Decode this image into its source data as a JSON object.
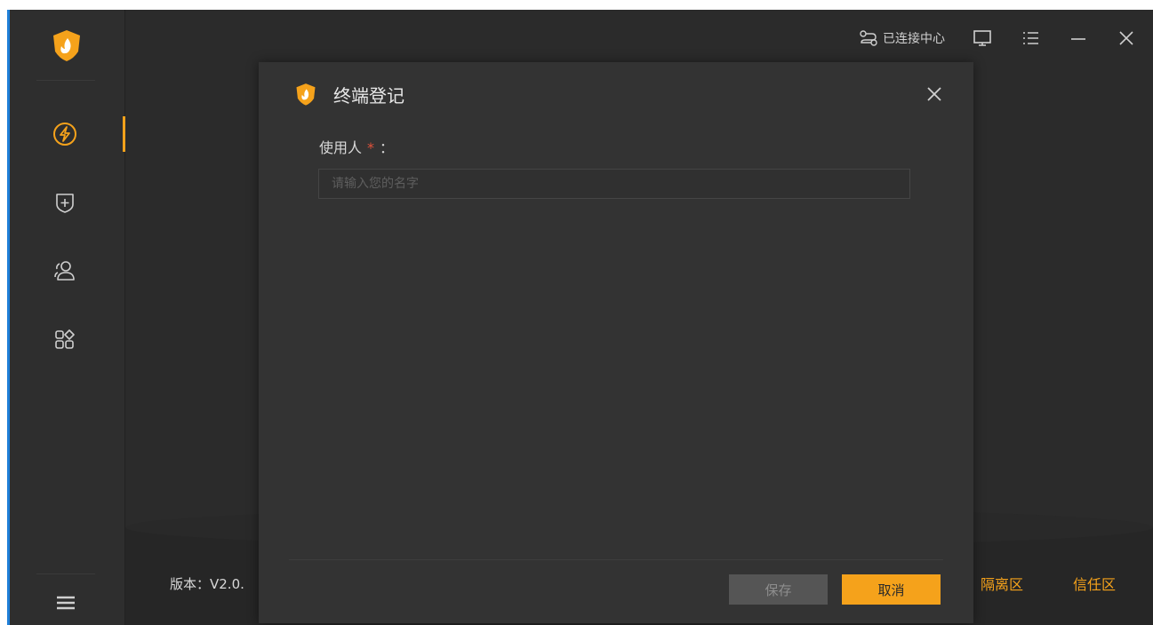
{
  "topbar": {
    "connection_status": "已连接中心"
  },
  "footer": {
    "version_label": "版本：V2.0.",
    "quarantine_link": "隔离区",
    "trust_link": "信任区"
  },
  "dialog": {
    "title": "终端登记",
    "field_label": "使用人",
    "required_mark": "*",
    "label_colon": "：",
    "input_placeholder": "请输入您的名字",
    "input_value": "",
    "save_label": "保存",
    "cancel_label": "取消"
  },
  "colors": {
    "accent": "#f5a21b",
    "required": "#e0513a",
    "window_border": "#1f7fd8"
  },
  "icons": {
    "sidebar": [
      "lightning-icon",
      "shield-plus-icon",
      "users-icon",
      "apps-icon"
    ],
    "bottom": "hamburger-menu-icon"
  }
}
